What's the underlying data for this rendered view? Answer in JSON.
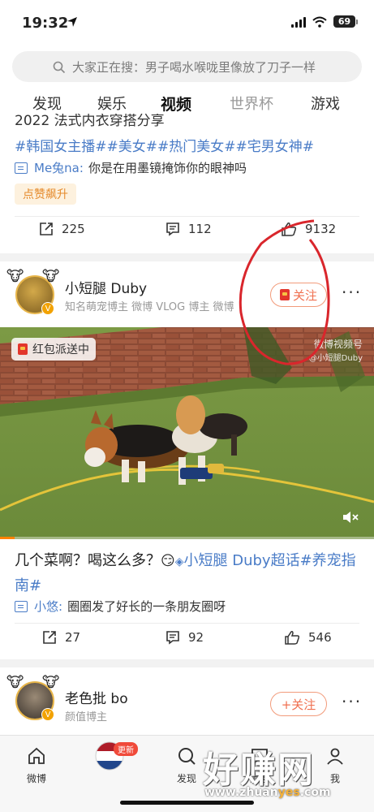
{
  "status": {
    "time": "19:32",
    "battery": "69"
  },
  "search": {
    "placeholder": "大家正在搜：男子喝水喉咙里像放了刀子一样"
  },
  "tabs": [
    {
      "label": "发现"
    },
    {
      "label": "娱乐"
    },
    {
      "label": "视频"
    },
    {
      "label": "世界杯"
    },
    {
      "label": "游戏"
    }
  ],
  "card1": {
    "title": "2022 法式内衣穿搭分享",
    "tags": "#韩国女主播##美女##热门美女##宅男女神#",
    "comment_user": "Me兔na:",
    "comment_text": "你是在用墨镜掩饰你的眼神吗",
    "badge": "点赞飙升",
    "reposts": "225",
    "comments": "112",
    "likes": "9132"
  },
  "card2": {
    "user_name": "小短腿 Duby",
    "user_desc": "知名萌宠博主 微博 VLOG 博主 微博",
    "follow_label": "关注",
    "video_tag": "红包派送中",
    "video_logo": "微博视频号",
    "video_logo_sub": "@小短腿Duby",
    "text_plain": "几个菜啊？喝这么多？",
    "text_tags": "小短腿 Duby超话#养宠指南#",
    "comment_user": "小悠:",
    "comment_text": "圈圈发了好长的一条朋友圈呀",
    "reposts": "27",
    "comments": "92",
    "likes": "546"
  },
  "card3": {
    "user_name": "老色批 bo",
    "user_desc": "颜值博主",
    "follow_label": "+关注"
  },
  "tabbar": {
    "home": "微博",
    "video_badge": "更新",
    "discover": "发现",
    "messages": "消息",
    "me": "我"
  },
  "watermark": {
    "title": "好赚网",
    "url_pre": "www.zhuan",
    "url_hl": "yes",
    "url_post": ".com"
  },
  "colors": {
    "accent": "#ff8200",
    "link": "#4a7cc7",
    "follow": "#f07050",
    "annotation": "#d9262c"
  }
}
